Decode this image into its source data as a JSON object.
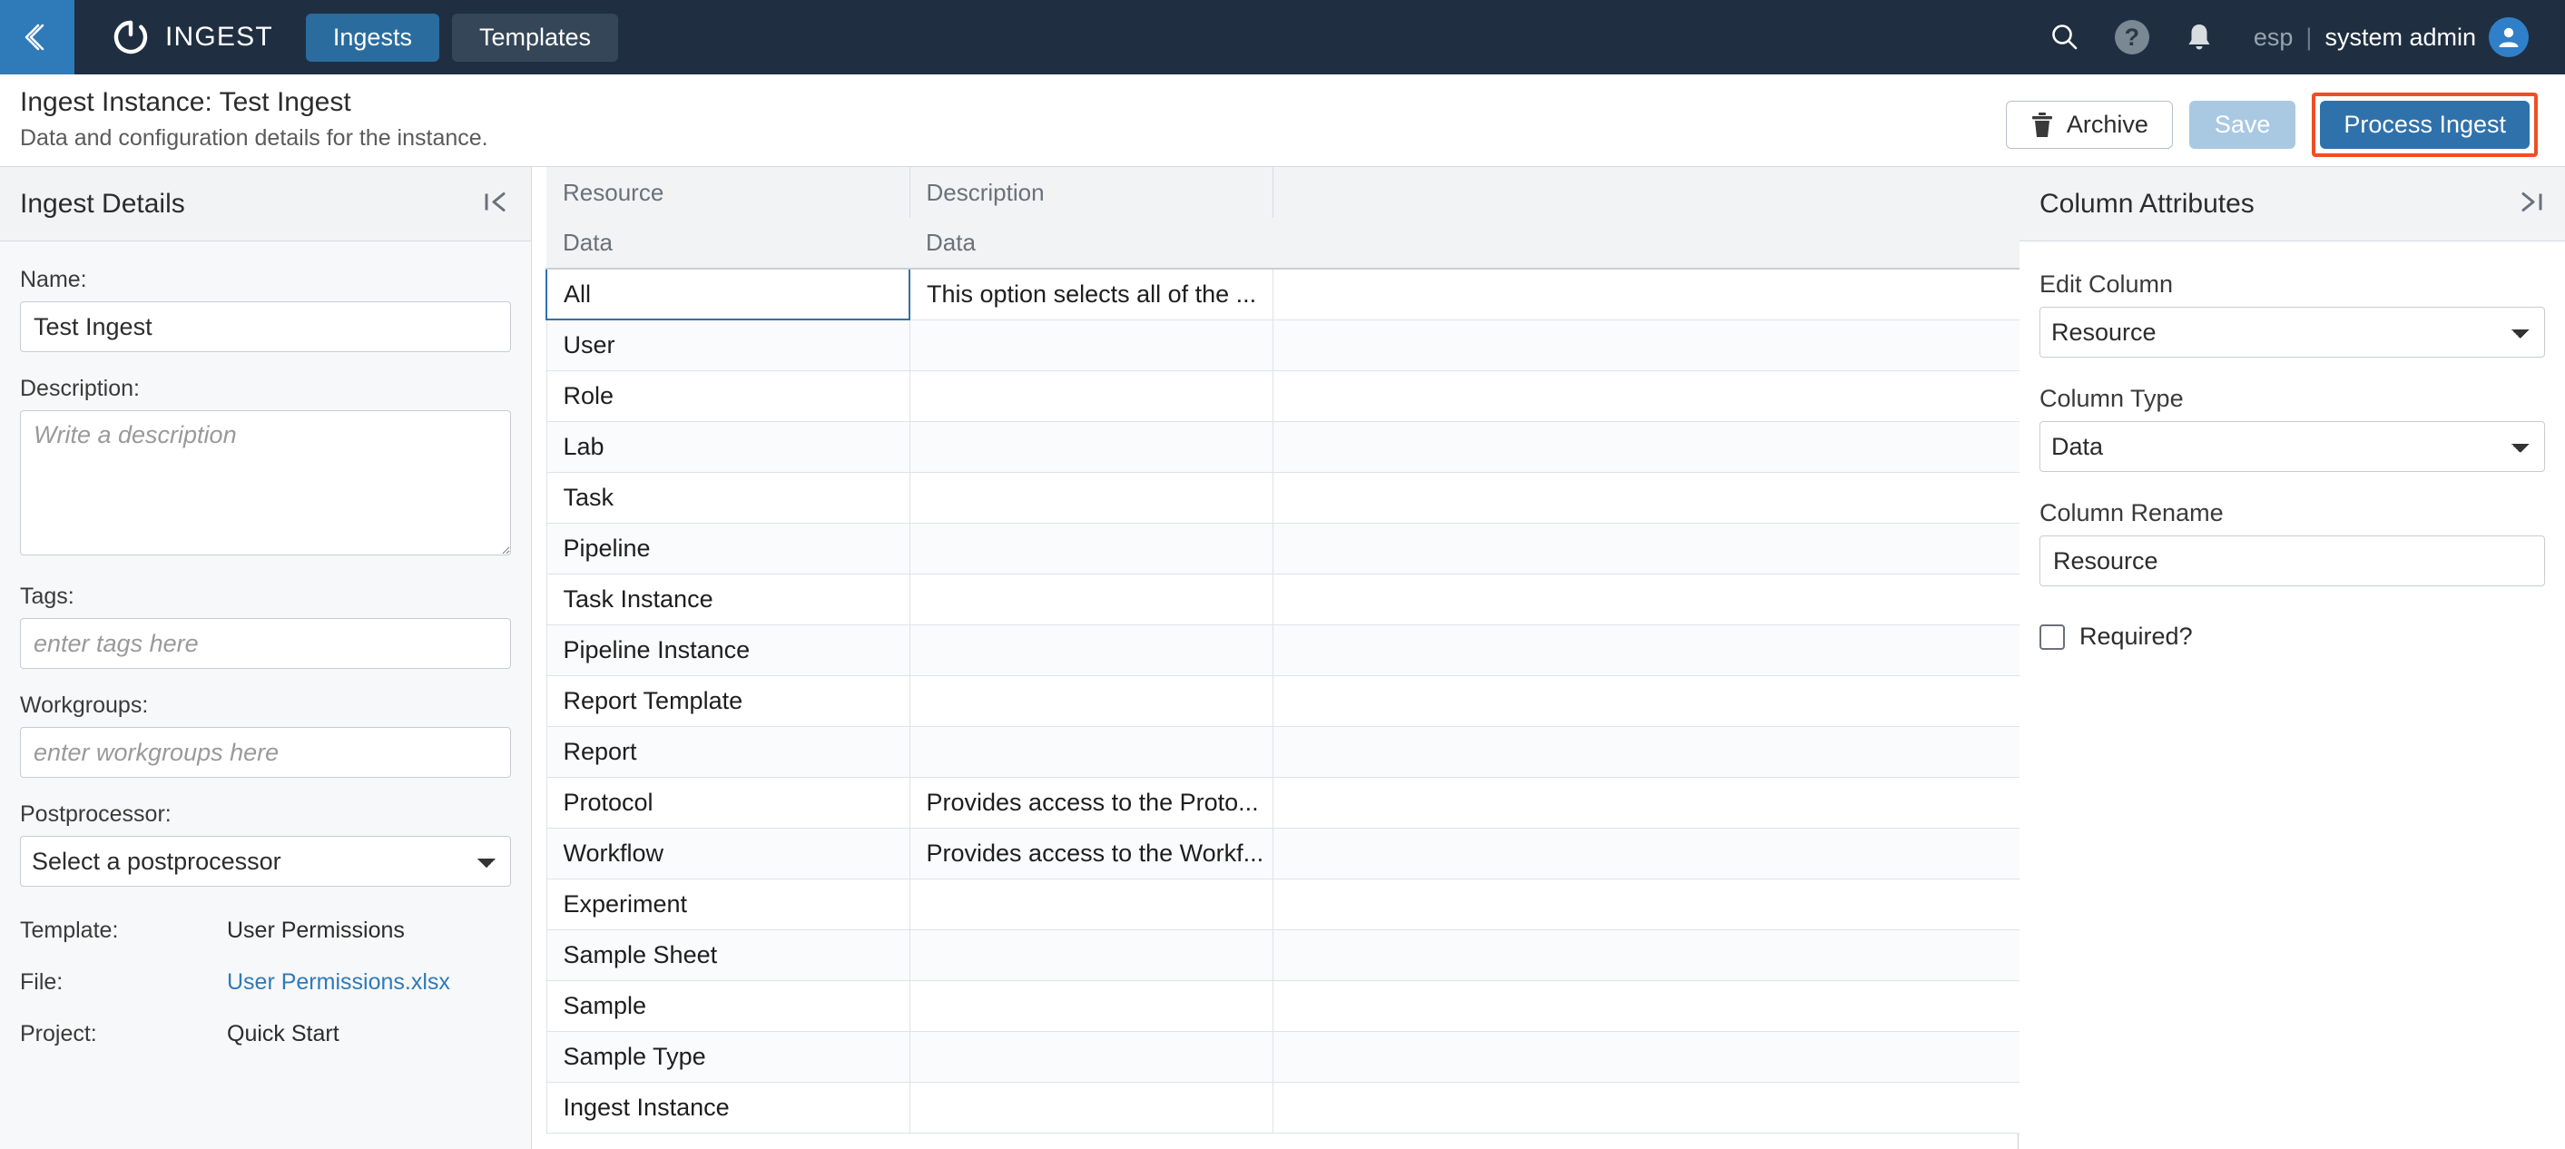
{
  "topnav": {
    "back_icon": "chevron-double-left-icon",
    "brand": "INGEST",
    "logo_icon": "ingest-ring-logo",
    "tabs": [
      {
        "label": "Ingests",
        "active": true
      },
      {
        "label": "Templates",
        "active": false
      }
    ],
    "search_icon": "search-icon",
    "help_icon": "help-question-icon",
    "help_glyph": "?",
    "notifications_icon": "bell-icon",
    "org_label": "esp",
    "separator": "|",
    "user_name": "system admin",
    "avatar_icon": "user-avatar-icon"
  },
  "titlebar": {
    "title": "Ingest Instance: Test Ingest",
    "subtitle": "Data and configuration details for the instance.",
    "archive_label": "Archive",
    "archive_icon": "trash-icon",
    "save_label": "Save",
    "process_label": "Process Ingest",
    "highlight_color": "#f04e23"
  },
  "left_panel": {
    "header": "Ingest Details",
    "collapse_icon": "collapse-left-icon",
    "name_label": "Name:",
    "name_value": "Test Ingest",
    "description_label": "Description:",
    "description_value": "",
    "description_placeholder": "Write a description",
    "tags_label": "Tags:",
    "tags_value": "",
    "tags_placeholder": "enter tags here",
    "workgroups_label": "Workgroups:",
    "workgroups_value": "",
    "workgroups_placeholder": "enter workgroups here",
    "postprocessor_label": "Postprocessor:",
    "postprocessor_value": "Select a postprocessor",
    "meta": [
      {
        "key": "Template:",
        "value": "User Permissions",
        "link": false
      },
      {
        "key": "File:",
        "value": "User Permissions.xlsx",
        "link": true
      },
      {
        "key": "Project:",
        "value": "Quick Start",
        "link": false
      }
    ]
  },
  "table": {
    "headers": [
      "Resource",
      "Description",
      ""
    ],
    "subheaders": [
      "Data",
      "Data",
      ""
    ],
    "rows": [
      {
        "resource": "All",
        "description": "This option selects all of the ...",
        "selected": true
      },
      {
        "resource": "User",
        "description": "",
        "selected": false
      },
      {
        "resource": "Role",
        "description": "",
        "selected": false
      },
      {
        "resource": "Lab",
        "description": "",
        "selected": false
      },
      {
        "resource": "Task",
        "description": "",
        "selected": false
      },
      {
        "resource": "Pipeline",
        "description": "",
        "selected": false
      },
      {
        "resource": "Task Instance",
        "description": "",
        "selected": false
      },
      {
        "resource": "Pipeline Instance",
        "description": "",
        "selected": false
      },
      {
        "resource": "Report Template",
        "description": "",
        "selected": false
      },
      {
        "resource": "Report",
        "description": "",
        "selected": false
      },
      {
        "resource": "Protocol",
        "description": "Provides access to the Proto...",
        "selected": false
      },
      {
        "resource": "Workflow",
        "description": "Provides access to the Workf...",
        "selected": false
      },
      {
        "resource": "Experiment",
        "description": "",
        "selected": false
      },
      {
        "resource": "Sample Sheet",
        "description": "",
        "selected": false
      },
      {
        "resource": "Sample",
        "description": "",
        "selected": false
      },
      {
        "resource": "Sample Type",
        "description": "",
        "selected": false
      },
      {
        "resource": "Ingest Instance",
        "description": "",
        "selected": false
      }
    ]
  },
  "right_panel": {
    "header": "Column Attributes",
    "collapse_icon": "collapse-right-icon",
    "edit_column_label": "Edit Column",
    "edit_column_value": "Resource",
    "column_type_label": "Column Type",
    "column_type_value": "Data",
    "column_rename_label": "Column Rename",
    "column_rename_value": "Resource",
    "required_label": "Required?",
    "required_checked": false
  }
}
